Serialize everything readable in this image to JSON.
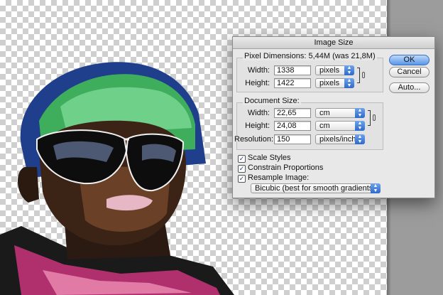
{
  "dialog": {
    "title": "Image Size",
    "pixel_dimensions": {
      "label": "Pixel Dimensions:",
      "size_info": "5,44M (was 21,8M)",
      "width_label": "Width:",
      "width_value": "1338",
      "width_unit": "pixels",
      "height_label": "Height:",
      "height_value": "1422",
      "height_unit": "pixels"
    },
    "document_size": {
      "label": "Document Size:",
      "width_label": "Width:",
      "width_value": "22,65",
      "width_unit": "cm",
      "height_label": "Height:",
      "height_value": "24,08",
      "height_unit": "cm",
      "resolution_label": "Resolution:",
      "resolution_value": "150",
      "resolution_unit": "pixels/inch"
    },
    "buttons": {
      "ok": "OK",
      "cancel": "Cancel",
      "auto": "Auto..."
    },
    "options": {
      "scale_styles": {
        "label": "Scale Styles",
        "checked": true
      },
      "constrain_proportions": {
        "label": "Constrain Proportions",
        "checked": true
      },
      "resample_image": {
        "label": "Resample Image:",
        "checked": true
      },
      "resample_method": "Bicubic (best for smooth gradients)"
    }
  },
  "colors": {
    "accent": "#3f7fdc",
    "canvas_gray": "#9c9c9c",
    "hat_green": "#3fae5c",
    "hat_blue": "#2c5fb8"
  }
}
